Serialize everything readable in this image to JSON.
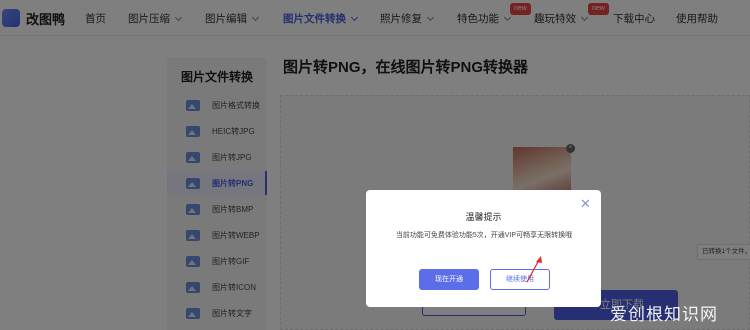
{
  "logo": {
    "text": "改图鸭"
  },
  "nav": {
    "items": [
      {
        "label": "首页",
        "dropdown": false
      },
      {
        "label": "图片压缩",
        "dropdown": true
      },
      {
        "label": "图片编辑",
        "dropdown": true
      },
      {
        "label": "图片文件转换",
        "dropdown": true,
        "active": true
      },
      {
        "label": "照片修复",
        "dropdown": true
      },
      {
        "label": "特色功能",
        "dropdown": true,
        "badge": "new"
      },
      {
        "label": "趣玩特效",
        "dropdown": true,
        "badge": "new"
      },
      {
        "label": "下载中心",
        "dropdown": false
      },
      {
        "label": "使用帮助",
        "dropdown": false
      }
    ]
  },
  "sidebar": {
    "title": "图片文件转换",
    "items": [
      {
        "label": "图片格式转换"
      },
      {
        "label": "HEIC转JPG"
      },
      {
        "label": "图片转JPG"
      },
      {
        "label": "图片转PNG",
        "active": true
      },
      {
        "label": "图片转BMP"
      },
      {
        "label": "图片转WEBP"
      },
      {
        "label": "图片转GIF"
      },
      {
        "label": "图片转ICON"
      },
      {
        "label": "图片转文字"
      }
    ]
  },
  "main": {
    "title": "图片转PNG，在线图片转PNG转换器",
    "download_button": "立即下载",
    "toast": "已转换1个文件，"
  },
  "modal": {
    "title": "温馨提示",
    "message": "当前功能可免费体验功能5次，开通VIP可畅享无限转换哦",
    "primary_button": "现在开通",
    "secondary_button": "继续使用"
  },
  "watermark": "爱创根知识网",
  "colors": {
    "accent": "#4a5fe2",
    "badge": "#e84545",
    "overlay": "rgba(0,0,0,0.5)"
  }
}
